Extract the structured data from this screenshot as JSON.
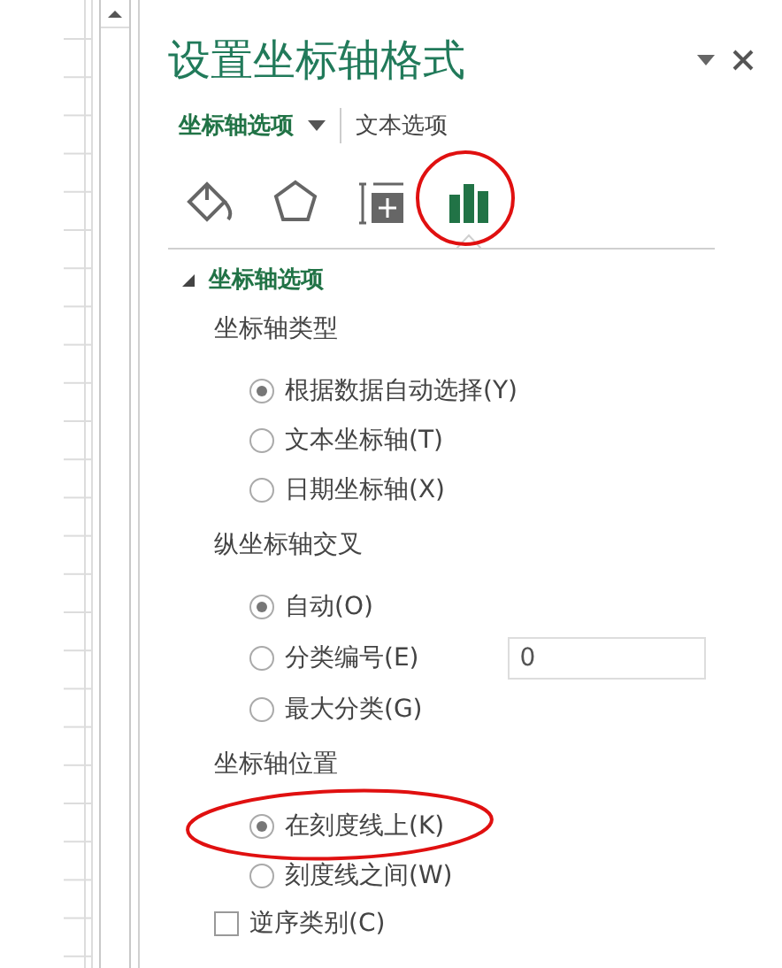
{
  "pane": {
    "title": "设置坐标轴格式",
    "tabs": [
      {
        "label": "坐标轴选项",
        "selected": true,
        "dropdown": true
      },
      {
        "label": "文本选项",
        "selected": false,
        "dropdown": false
      }
    ],
    "icons": [
      {
        "kind": "fill",
        "selected": false
      },
      {
        "kind": "effects",
        "selected": false
      },
      {
        "kind": "size",
        "selected": false
      },
      {
        "kind": "axis",
        "selected": true
      }
    ],
    "section": {
      "title": "坐标轴选项",
      "expanded": true,
      "groups": [
        {
          "label": "坐标轴类型",
          "options": [
            {
              "label": "根据数据自动选择(Y)",
              "selected": true
            },
            {
              "label": "文本坐标轴(T)",
              "selected": false
            },
            {
              "label": "日期坐标轴(X)",
              "selected": false
            }
          ]
        },
        {
          "label": "纵坐标轴交叉",
          "options": [
            {
              "label": "自动(O)",
              "selected": true
            },
            {
              "label": "分类编号(E)",
              "selected": false,
              "field": {
                "value": "0"
              }
            },
            {
              "label": "最大分类(G)",
              "selected": false
            }
          ]
        },
        {
          "label": "坐标轴位置",
          "options": [
            {
              "label": "在刻度线上(K)",
              "selected": true
            },
            {
              "label": "刻度线之间(W)",
              "selected": false
            }
          ]
        }
      ],
      "checkboxes": [
        {
          "label": "逆序类别(C)",
          "checked": false
        }
      ]
    }
  }
}
